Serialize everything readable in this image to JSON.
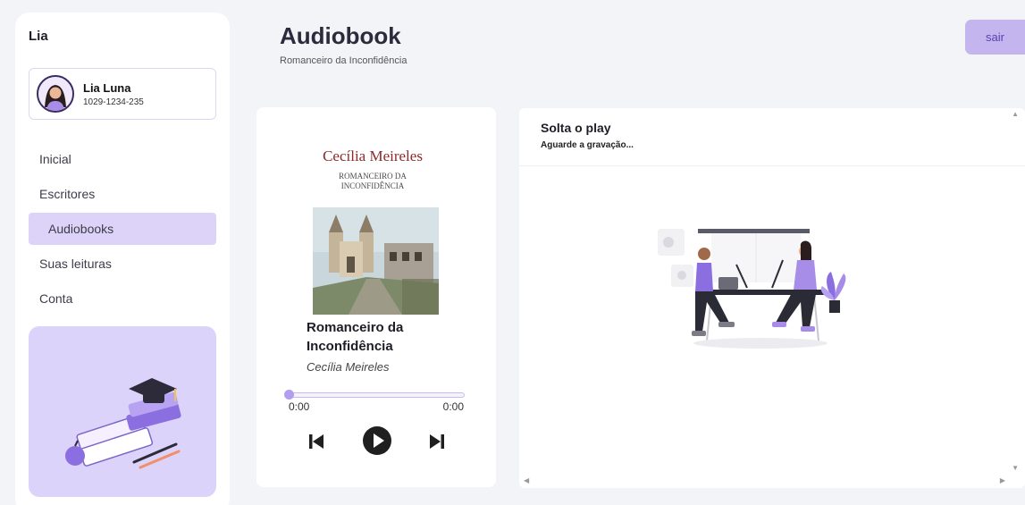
{
  "sidebar": {
    "brand": "Lia",
    "user": {
      "name": "Lia Luna",
      "id": "1029-1234-235"
    },
    "nav": [
      {
        "label": "Inicial"
      },
      {
        "label": "Escritores"
      },
      {
        "label": "Audiobooks",
        "active": true
      },
      {
        "label": "Suas leituras"
      },
      {
        "label": "Conta"
      }
    ]
  },
  "header": {
    "title": "Audiobook",
    "subtitle": "Romanceiro da Inconfidência",
    "logout_label": "sair"
  },
  "player": {
    "cover_author": "Cecília Meireles",
    "cover_title_line1": "ROMANCEIRO DA",
    "cover_title_line2": "INCONFIDÊNCIA",
    "book_title": "Romanceiro da Inconfidência",
    "book_author": "Cecília Meireles",
    "current_time": "0:00",
    "duration": "0:00",
    "progress": 0
  },
  "panel": {
    "title": "Solta o play",
    "subtitle": "Aguarde a gravação..."
  },
  "colors": {
    "accent": "#c5b5ef",
    "accent_dark": "#5a3fb0",
    "active_nav": "#ddd3f8",
    "background": "#f3f4f8"
  }
}
